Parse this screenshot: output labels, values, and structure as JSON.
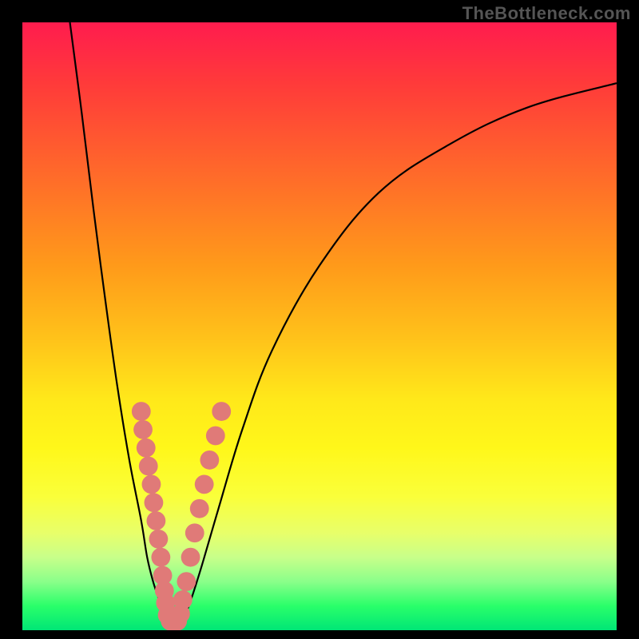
{
  "watermark": "TheBottleneck.com",
  "colors": {
    "frame": "#000000",
    "gradient_top": "#ff1c4e",
    "gradient_bottom": "#00e676",
    "curve": "#000000",
    "bead": "#e07a78"
  },
  "chart_data": {
    "type": "line",
    "title": "",
    "xlabel": "",
    "ylabel": "",
    "xlim": [
      0,
      100
    ],
    "ylim": [
      0,
      100
    ],
    "grid": false,
    "legend": false,
    "series": [
      {
        "name": "left-curve",
        "x": [
          8,
          10,
          12,
          14,
          16,
          18,
          20,
          21,
          22,
          23,
          23.7,
          24.2
        ],
        "y": [
          100,
          85,
          69,
          54,
          40,
          28,
          18,
          12,
          8,
          5,
          2.5,
          1
        ]
      },
      {
        "name": "right-curve",
        "x": [
          26.5,
          28,
          30,
          33,
          37,
          42,
          50,
          60,
          72,
          85,
          100
        ],
        "y": [
          1,
          4,
          10,
          20,
          33,
          46,
          60,
          72,
          80,
          86,
          90
        ]
      }
    ],
    "bead_clusters": [
      {
        "name": "left-arm-beads",
        "points": [
          {
            "x": 20.0,
            "y": 36,
            "r": 1.6
          },
          {
            "x": 20.3,
            "y": 33,
            "r": 1.6
          },
          {
            "x": 20.8,
            "y": 30,
            "r": 1.6
          },
          {
            "x": 21.2,
            "y": 27,
            "r": 1.6
          },
          {
            "x": 21.7,
            "y": 24,
            "r": 1.6
          },
          {
            "x": 22.1,
            "y": 21,
            "r": 1.6
          },
          {
            "x": 22.5,
            "y": 18,
            "r": 1.6
          },
          {
            "x": 22.9,
            "y": 15,
            "r": 1.6
          },
          {
            "x": 23.3,
            "y": 12,
            "r": 1.6
          },
          {
            "x": 23.6,
            "y": 9,
            "r": 1.6
          },
          {
            "x": 23.9,
            "y": 6.5,
            "r": 1.6
          },
          {
            "x": 24.1,
            "y": 4.5,
            "r": 1.6
          }
        ]
      },
      {
        "name": "right-arm-beads",
        "points": [
          {
            "x": 27.0,
            "y": 5,
            "r": 1.6
          },
          {
            "x": 27.6,
            "y": 8,
            "r": 1.6
          },
          {
            "x": 28.3,
            "y": 12,
            "r": 1.6
          },
          {
            "x": 29.0,
            "y": 16,
            "r": 1.6
          },
          {
            "x": 29.8,
            "y": 20,
            "r": 1.6
          },
          {
            "x": 30.6,
            "y": 24,
            "r": 1.6
          },
          {
            "x": 31.5,
            "y": 28,
            "r": 1.6
          },
          {
            "x": 32.5,
            "y": 32,
            "r": 1.6
          },
          {
            "x": 33.5,
            "y": 36,
            "r": 1.6
          }
        ]
      },
      {
        "name": "vertex-beads",
        "points": [
          {
            "x": 24.4,
            "y": 2.5,
            "r": 1.6
          },
          {
            "x": 24.9,
            "y": 1.5,
            "r": 1.6
          },
          {
            "x": 25.5,
            "y": 1.2,
            "r": 1.6
          },
          {
            "x": 26.1,
            "y": 1.5,
            "r": 1.6
          },
          {
            "x": 26.6,
            "y": 2.7,
            "r": 1.6
          }
        ]
      }
    ]
  }
}
